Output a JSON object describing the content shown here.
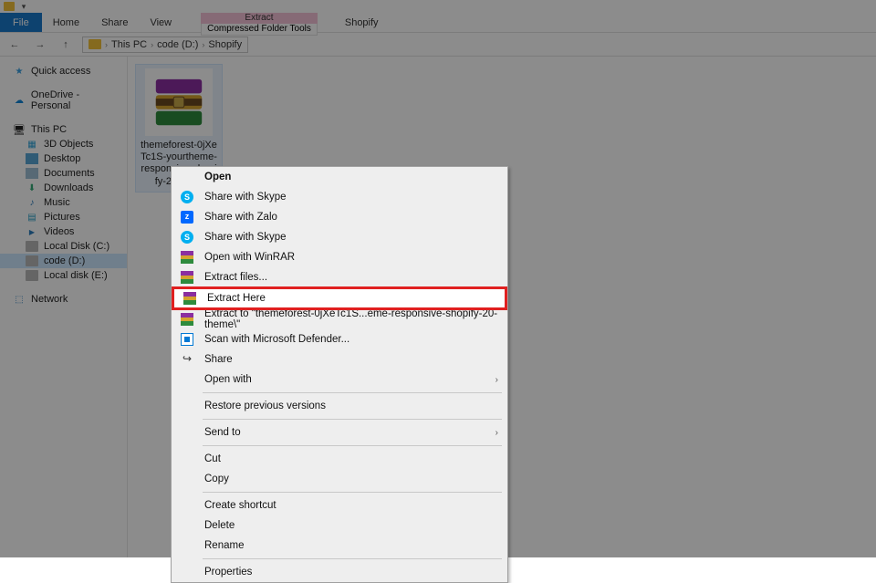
{
  "titlebar": {
    "qat_glyph": "▾"
  },
  "ribbon": {
    "file": "File",
    "home": "Home",
    "share": "Share",
    "view": "View",
    "context_header": "Extract",
    "context_tab": "Compressed Folder Tools",
    "window_title": "Shopify"
  },
  "addr": {
    "back": "←",
    "forward": "→",
    "up": "↑",
    "crumbs": [
      "This PC",
      "code (D:)",
      "Shopify"
    ],
    "sep": "›"
  },
  "nav": {
    "quick": "Quick access",
    "onedrive": "OneDrive - Personal",
    "thispc": "This PC",
    "obj3d": "3D Objects",
    "desktop": "Desktop",
    "documents": "Documents",
    "downloads": "Downloads",
    "music": "Music",
    "pictures": "Pictures",
    "videos": "Videos",
    "localc": "Local Disk (C:)",
    "coded": "code (D:)",
    "locale": "Local disk (E:)",
    "network": "Network"
  },
  "file": {
    "name": "themeforest-0jXeTc1S-yourtheme-responsive-shopify-20-them"
  },
  "ctx": {
    "open": "Open",
    "skype1": "Share with Skype",
    "zalo": "Share with Zalo",
    "skype2": "Share with Skype",
    "openrar": "Open with WinRAR",
    "extractfiles": "Extract files...",
    "extracthere": "Extract Here",
    "extractto": "Extract to \"themeforest-0jXeTc1S...eme-responsive-shopify-20-theme\\\"",
    "defender": "Scan with Microsoft Defender...",
    "share": "Share",
    "openwith": "Open with",
    "restore": "Restore previous versions",
    "sendto": "Send to",
    "cut": "Cut",
    "copy": "Copy",
    "shortcut": "Create shortcut",
    "delete": "Delete",
    "rename": "Rename",
    "properties": "Properties",
    "arrow": "›"
  }
}
